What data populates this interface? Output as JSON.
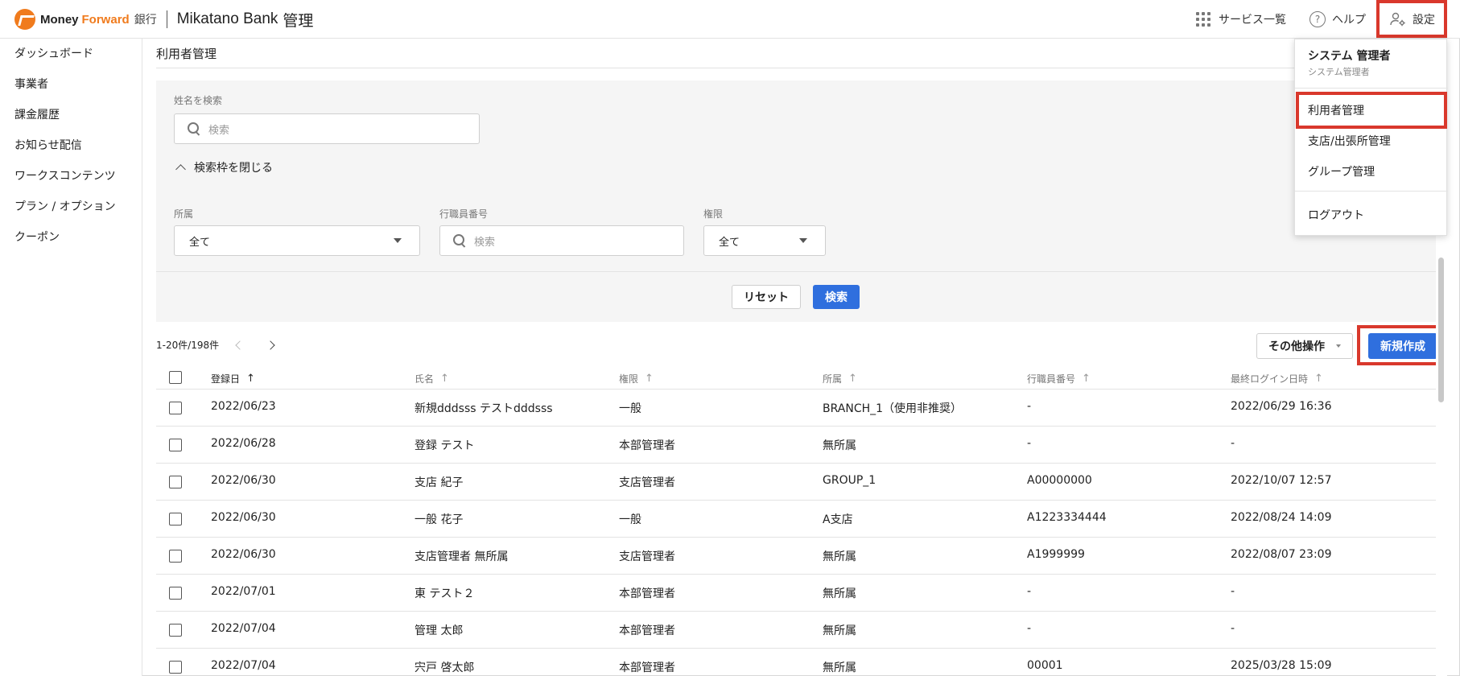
{
  "header": {
    "logo_money": "Money",
    "logo_forward": "Forward",
    "logo_bank": "銀行",
    "logo_product": "Mikatano Bank",
    "logo_suffix": "管理",
    "services_label": "サービス一覧",
    "help_label": "ヘルプ",
    "settings_label": "設定"
  },
  "sidebar": {
    "items": [
      {
        "label": "ダッシュボード"
      },
      {
        "label": "事業者"
      },
      {
        "label": "課金履歴"
      },
      {
        "label": "お知らせ配信"
      },
      {
        "label": "ワークスコンテンツ"
      },
      {
        "label": "プラン / オプション"
      },
      {
        "label": "クーポン"
      }
    ]
  },
  "page": {
    "title": "利用者管理"
  },
  "search": {
    "name_label": "姓名を検索",
    "name_placeholder": "検索",
    "collapse_label": "検索枠を閉じる",
    "affiliation_label": "所属",
    "affiliation_value": "全て",
    "staff_label": "行職員番号",
    "staff_placeholder": "検索",
    "role_label": "権限",
    "role_value": "全て",
    "reset_label": "リセット",
    "search_label": "検索"
  },
  "list": {
    "pager_text": "1-20件/198件",
    "more_label": "その他操作",
    "new_label": "新規作成"
  },
  "table": {
    "columns": [
      "登録日",
      "氏名",
      "権限",
      "所属",
      "行職員番号",
      "最終ログイン日時"
    ],
    "rows": [
      [
        "2022/06/23",
        "新規dddsss テストdddsss",
        "一般",
        "BRANCH_1（使用非推奨）",
        "-",
        "2022/06/29 16:36"
      ],
      [
        "2022/06/28",
        "登録 テスト",
        "本部管理者",
        "無所属",
        "-",
        "-"
      ],
      [
        "2022/06/30",
        "支店 紀子",
        "支店管理者",
        "GROUP_1",
        "A00000000",
        "2022/10/07 12:57"
      ],
      [
        "2022/06/30",
        "一般 花子",
        "一般",
        "A支店",
        "A1223334444",
        "2022/08/24 14:09"
      ],
      [
        "2022/06/30",
        "支店管理者 無所属",
        "支店管理者",
        "無所属",
        "A1999999",
        "2022/08/07 23:09"
      ],
      [
        "2022/07/01",
        "東 テスト２",
        "本部管理者",
        "無所属",
        "-",
        "-"
      ],
      [
        "2022/07/04",
        "管理 太郎",
        "本部管理者",
        "無所属",
        "-",
        "-"
      ],
      [
        "2022/07/04",
        "宍戸 啓太郎",
        "本部管理者",
        "無所属",
        "00001",
        "2025/03/28 15:09"
      ]
    ]
  },
  "menu": {
    "user_name": "システム 管理者",
    "user_role": "システム管理者",
    "items": [
      "利用者管理",
      "支店/出張所管理",
      "グループ管理"
    ],
    "logout": "ログアウト"
  },
  "colors": {
    "accent": "#2f6fde",
    "brand": "#f07b1d",
    "highlight": "#d9382c"
  }
}
